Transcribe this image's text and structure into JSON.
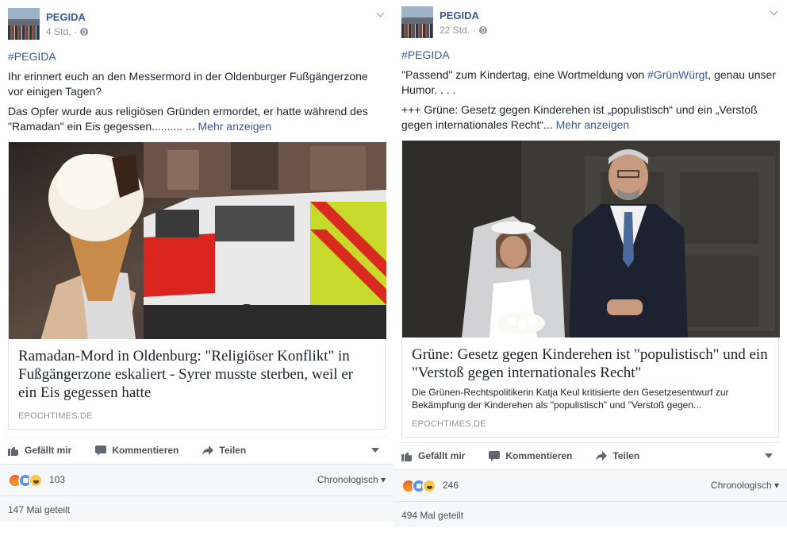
{
  "posts": [
    {
      "page_name": "PEGIDA",
      "time": "4 Std.",
      "separator": "·",
      "hashtag": "#PEGIDA",
      "paragraph1": "Ihr erinnert euch an den Messermord in der Oldenburger Fußgängerzone vor einigen Tagen?",
      "paragraph2": "Das Opfer wurde aus religiösen Gründen ermordet, er hatte während des \"Ramadan\" ein Eis gegessen.......... ...",
      "more_link": "Mehr anzeigen",
      "link_title": "Ramadan-Mord in Oldenburg: \"Religiöser Konflikt\" in Fußgängerzone eskaliert - Syrer musste sterben, weil er ein Eis gegessen hatte",
      "link_domain": "EPOCHTIMES.DE",
      "actions": {
        "like": "Gefällt mir",
        "comment": "Kommentieren",
        "share": "Teilen"
      },
      "reaction_count": "103",
      "sort_label": "Chronologisch ▾",
      "shares": "147 Mal geteilt"
    },
    {
      "page_name": "PEGIDA",
      "time": "22 Std.",
      "separator": "·",
      "hashtag": "#PEGIDA",
      "paragraph1_a": "\"Passend\" zum Kindertag, eine Wortmeldung von ",
      "paragraph1_tag": "#GrünWürgt",
      "paragraph1_b": ", genau unser Humor. . . .",
      "paragraph2": "+++ Grüne: Gesetz gegen Kinderehen ist „populistisch“ und ein „Verstoß gegen internationales Recht“...",
      "more_link": "Mehr anzeigen",
      "link_title": "Grüne: Gesetz gegen Kinderehen ist \"populistisch\" und ein \"Verstoß gegen internationales Recht\"",
      "link_description": "Die Grünen-Rechtspolitikerin Katja Keul kritisierte den Gesetzesentwurf zur Bekämpfung der Kinderehen als \"populistisch\" und \"Verstoß gegen...",
      "link_domain": "EPOCHTIMES.DE",
      "actions": {
        "like": "Gefällt mir",
        "comment": "Kommentieren",
        "share": "Teilen"
      },
      "reaction_count": "246",
      "sort_label": "Chronologisch ▾",
      "shares": "494 Mal geteilt"
    }
  ],
  "colors": {
    "link_blue": "#365899",
    "meta_gray": "#90949c",
    "bar_bg": "#f6f7f9"
  }
}
